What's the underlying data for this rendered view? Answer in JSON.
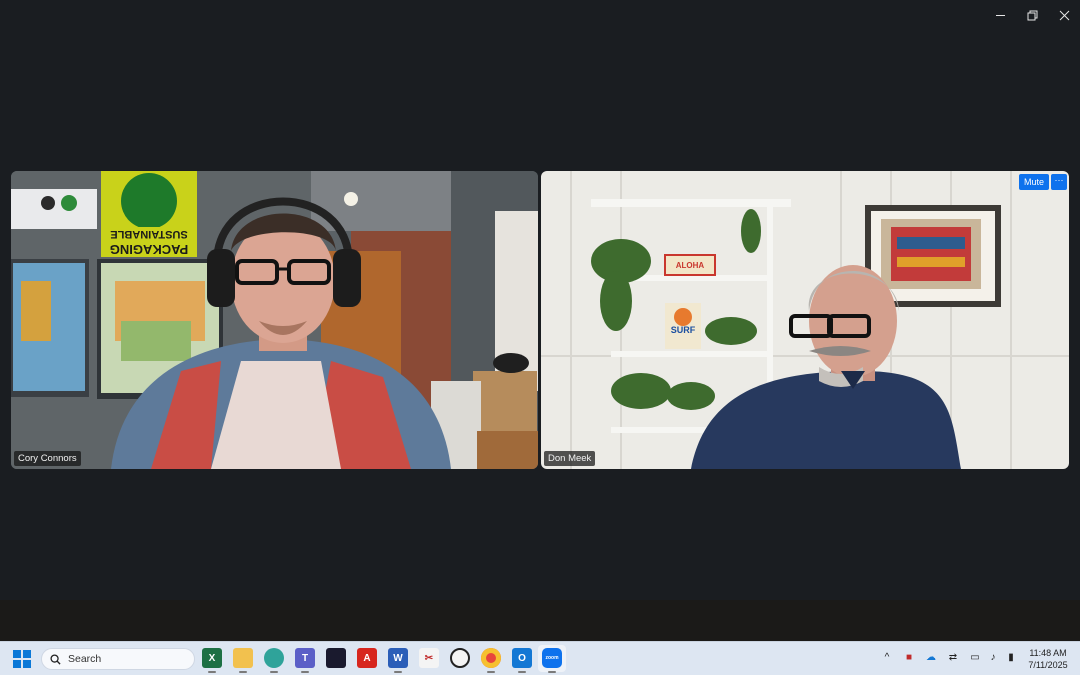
{
  "window": {
    "controls": [
      "minimize",
      "restore",
      "close"
    ]
  },
  "participants": [
    {
      "name": "Cory Connors"
    },
    {
      "name": "Don Meek",
      "mute_label": "Mute",
      "more_label": "···"
    }
  ],
  "left_scene": {
    "poster_text_1": "SUSTAINABLE",
    "poster_text_2": "PACKAGING"
  },
  "right_scene": {
    "sign_aloha": "ALOHA",
    "sign_surf": "SURF"
  },
  "taskbar": {
    "search_placeholder": "Search",
    "apps": [
      "excel-icon",
      "file-explorer-icon",
      "edge-icon",
      "teams-icon",
      "webex-icon",
      "acrobat-icon",
      "word-icon",
      "snipping-icon",
      "obs-icon",
      "chrome-icon",
      "outlook-icon",
      "zoom-icon"
    ],
    "zoom_label": "zoom",
    "clock_time": "11:48 AM",
    "clock_date": "7/11/2025"
  },
  "colors": {
    "background": "#1a1d21",
    "taskbar": "#dde6f2",
    "zoom_blue": "#0e72ed"
  }
}
